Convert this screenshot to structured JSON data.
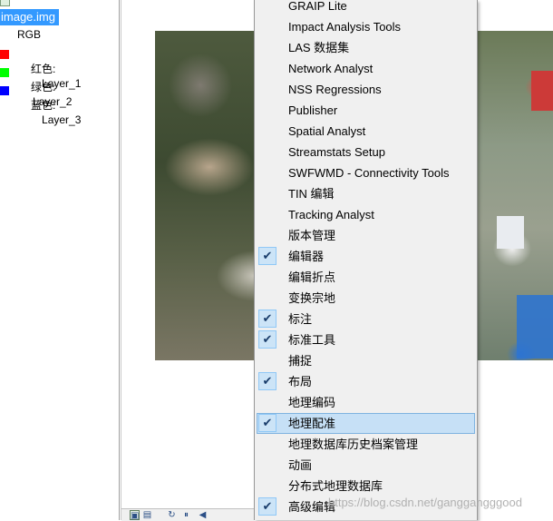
{
  "toc": {
    "layer_name": "image.img",
    "renderer_label": "RGB",
    "bands": [
      {
        "label": "红色:",
        "layer": "Layer_1",
        "color": "#ff0000"
      },
      {
        "label": "绿色:",
        "layer": "Layer_2",
        "color": "#00ff00"
      },
      {
        "label": "蓝色:",
        "layer": "Layer_3",
        "color": "#0000ff"
      }
    ]
  },
  "menu": {
    "items": [
      {
        "label": "GRAIP Lite",
        "checked": false
      },
      {
        "label": "Impact Analysis Tools",
        "checked": false
      },
      {
        "label": "LAS 数据集",
        "checked": false
      },
      {
        "label": "Network Analyst",
        "checked": false
      },
      {
        "label": "NSS Regressions",
        "checked": false
      },
      {
        "label": "Publisher",
        "checked": false
      },
      {
        "label": "Spatial Analyst",
        "checked": false
      },
      {
        "label": "Streamstats Setup",
        "checked": false
      },
      {
        "label": "SWFWMD - Connectivity Tools",
        "checked": false
      },
      {
        "label": "TIN 编辑",
        "checked": false
      },
      {
        "label": "Tracking Analyst",
        "checked": false
      },
      {
        "label": "版本管理",
        "checked": false
      },
      {
        "label": "编辑器",
        "checked": true
      },
      {
        "label": "编辑折点",
        "checked": false
      },
      {
        "label": "变换宗地",
        "checked": false
      },
      {
        "label": "标注",
        "checked": true
      },
      {
        "label": "标准工具",
        "checked": true
      },
      {
        "label": "捕捉",
        "checked": false
      },
      {
        "label": "布局",
        "checked": true
      },
      {
        "label": "地理编码",
        "checked": false
      },
      {
        "label": "地理配准",
        "checked": true,
        "selected": true
      },
      {
        "label": "地理数据库历史档案管理",
        "checked": false
      },
      {
        "label": "动画",
        "checked": false
      },
      {
        "label": "分布式地理数据库",
        "checked": false
      },
      {
        "label": "高级编辑",
        "checked": true
      }
    ],
    "check_glyph": "✔",
    "highlight_color": "#c6e0f6"
  },
  "bottom_bar": {
    "buttons": [
      "data-view-icon",
      "layout-view-icon",
      "refresh-icon",
      "pause-icon",
      "back-arrow-icon"
    ]
  },
  "watermark": "https://blog.csdn.net/ganggangggood"
}
